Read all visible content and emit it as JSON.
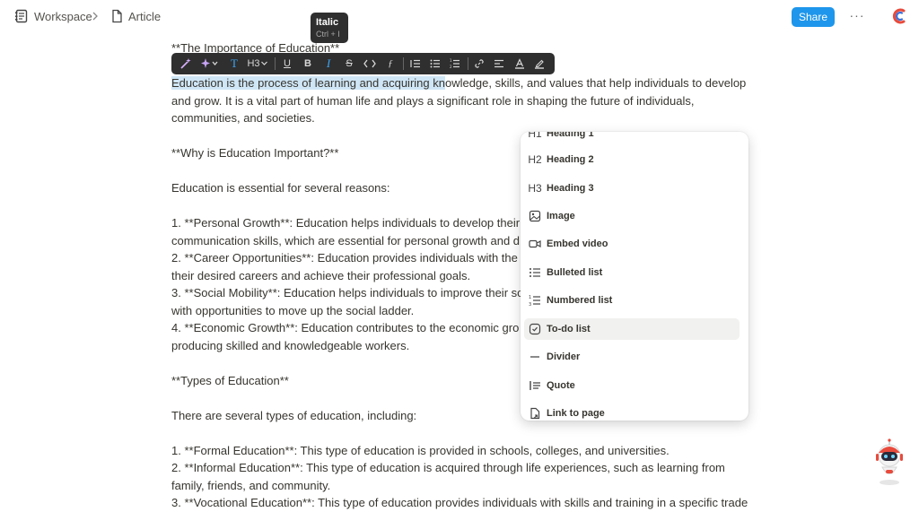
{
  "breadcrumb": {
    "workspace": "Workspace",
    "article": "Article"
  },
  "header": {
    "share_label": "Share",
    "more_label": "···"
  },
  "tooltip": {
    "title": "Italic",
    "shortcut": "Ctrl + I"
  },
  "toolbar": {
    "heading_level": "H3"
  },
  "document": {
    "lines": [
      "**The Importance of Education**",
      "Education is the process of learning and acquiring knowledge, skills, and values that help individuals to develop",
      "and grow. It is a vital part of human life and plays a significant role in shaping the future of individuals,",
      "communities, and societies.",
      "**Why is Education Important?**",
      "Education is essential for several reasons:",
      "1. **Personal Growth**: Education helps individuals to develop their",
      "communication skills, which are essential for personal growth and d",
      "2. **Career Opportunities**: Education provides individuals with the",
      "their desired careers and achieve their professional goals.",
      "3. **Social Mobility**: Education helps individuals to improve their so",
      "with opportunities to move up the social ladder.",
      "4. **Economic Growth**: Education contributes to the economic gro",
      "producing skilled and knowledgeable workers.",
      "**Types of Education**",
      "There are several types of education, including:",
      "1. **Formal Education**: This type of education is provided in schools, colleges, and universities.",
      "2. **Informal Education**: This type of education is acquired through life experiences, such as learning from",
      "family, friends, and community.",
      "3. **Vocational Education**: This type of education provides individuals with skills and training in a specific trade"
    ],
    "highlighted": "Education is the process of learning and acquiring kn",
    "line1_rest": "owledge, skills, and values that help individuals to develop"
  },
  "block_menu": {
    "items": [
      {
        "label": "Heading 1",
        "icon": "heading1-icon",
        "glyph": "H1"
      },
      {
        "label": "Heading 2",
        "icon": "heading2-icon",
        "glyph": "H2"
      },
      {
        "label": "Heading 3",
        "icon": "heading3-icon",
        "glyph": "H3"
      },
      {
        "label": "Image",
        "icon": "image-icon"
      },
      {
        "label": "Embed video",
        "icon": "video-icon"
      },
      {
        "label": "Bulleted list",
        "icon": "bulleted-list-icon"
      },
      {
        "label": "Numbered list",
        "icon": "numbered-list-icon"
      },
      {
        "label": "To-do list",
        "icon": "todo-list-icon"
      },
      {
        "label": "Divider",
        "icon": "divider-icon"
      },
      {
        "label": "Quote",
        "icon": "quote-icon"
      },
      {
        "label": "Link to page",
        "icon": "link-page-icon"
      }
    ],
    "active_item": "To-do list"
  },
  "colors": {
    "accent": "#1e96eb",
    "highlight": "#cfe6f6",
    "toolbar_bg": "#2f2f2f",
    "active_tool": "#3ba4f0"
  }
}
